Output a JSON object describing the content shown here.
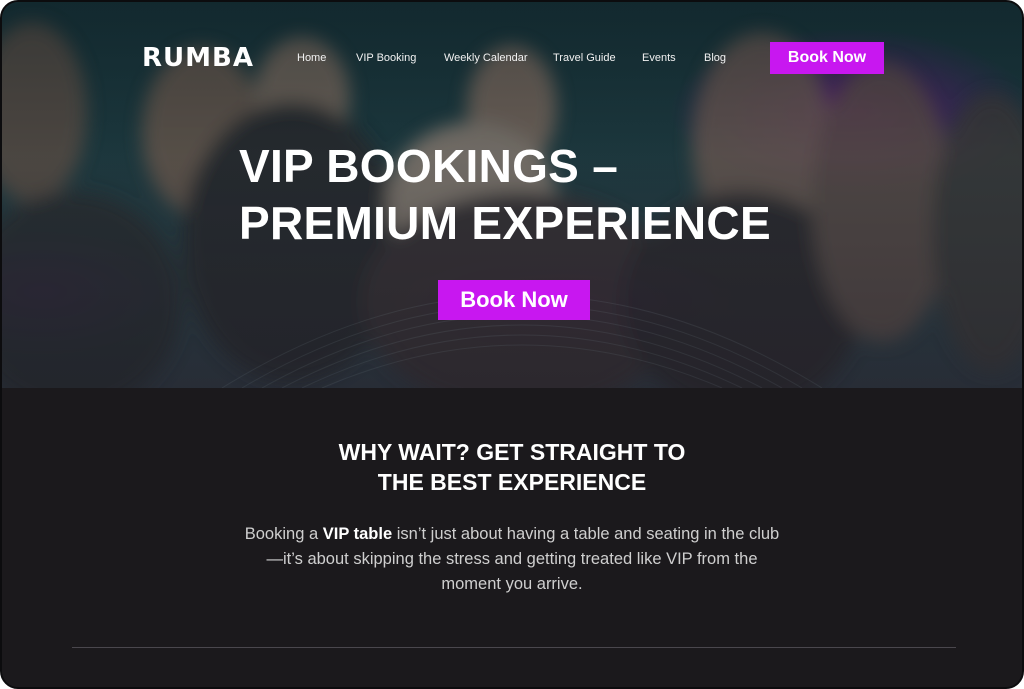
{
  "brand": {
    "logo": "RUMBA",
    "accent": "#c817f0"
  },
  "nav": {
    "links": [
      "Home",
      "VIP Booking",
      "Weekly Calendar",
      "Travel Guide",
      "Events",
      "Blog"
    ],
    "cta_label": "Book Now"
  },
  "hero": {
    "title_line1": "VIP BOOKINGS –",
    "title_line2": "PREMIUM EXPERIENCE",
    "cta_label": "Book Now"
  },
  "intro": {
    "heading_line1": "WHY WAIT? GET STRAIGHT TO",
    "heading_line2": "THE BEST EXPERIENCE",
    "body_prefix": "Booking a ",
    "body_bold": "VIP table",
    "body_line1_rest": " isn’t just about having a table and seating in the club",
    "body_line2": "—it’s about skipping the stress and getting treated like VIP from the",
    "body_line3": "moment you arrive."
  }
}
